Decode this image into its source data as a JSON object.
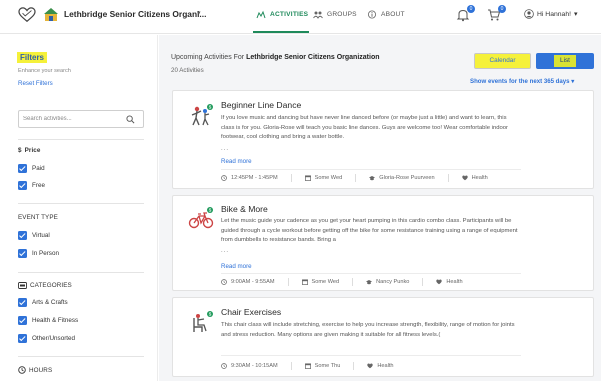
{
  "header": {
    "org_name": "Lethbridge Senior Citizens Organi...",
    "org_caret": "▾",
    "nav": [
      {
        "label": "ACTIVITIES",
        "active": true
      },
      {
        "label": "GROUPS",
        "active": false
      },
      {
        "label": "ABOUT",
        "active": false
      }
    ],
    "notif_count": "0",
    "cart_count": "0",
    "user_greeting": "Hi Hannah!",
    "user_caret": "▾"
  },
  "sidebar": {
    "title": "Filters",
    "subtitle": "Enhance your search",
    "reset": "Reset Filters",
    "search_placeholder": "Search activities...",
    "price": {
      "label": "Price",
      "options": [
        "Paid",
        "Free"
      ]
    },
    "event_type": {
      "label": "EVENT TYPE",
      "options": [
        "Virtual",
        "In Person"
      ]
    },
    "categories": {
      "label": "CATEGORIES",
      "options": [
        "Arts & Crafts",
        "Health & Fitness",
        "Other/Unsorted"
      ]
    },
    "hours": {
      "label": "HOURS"
    }
  },
  "main": {
    "upcoming_prefix": "Upcoming Activities For ",
    "upcoming_org": "Lethbridge Senior Citizens Organization",
    "count": "20 Activities",
    "calendar_label": "Calendar",
    "list_label": "List",
    "show_events": "Show events for the next 365 days",
    "show_caret": "▾",
    "cards": [
      {
        "title": "Beginner Line Dance",
        "desc": "If you love music and dancing but have never line danced before (or maybe just a little) and want to learn, this class is for you. Gloria-Rose will teach you basic line dances. Guys are welcome too! Wear comfortable indoor footwear, cool clothing and bring a water bottle.",
        "dots": "...",
        "read_more": "Read more",
        "time": "12:45PM - 1:45PM",
        "day": "Some Wed",
        "instructor": "Gloria-Rose Puurveen",
        "category": "Health"
      },
      {
        "title": "Bike & More",
        "desc": "Let the music guide your cadence as you get your heart pumping in this cardio combo class. Participants will be guided through a cycle workout before getting off the bike for some resistance training using a range of equipment from dumbbells to resistance bands. Bring a",
        "dots": "...",
        "read_more": "Read more",
        "time": "9:00AM - 9:55AM",
        "day": "Some Wed",
        "instructor": "Nancy Punko",
        "category": "Health"
      },
      {
        "title": "Chair Exercises",
        "desc": "This chair class will include stretching, exercise to help you increase strength, flexibility, range of motion for joints and stress reduction. Many options are given making it suitable for all fitness levels.(",
        "time": "9:30AM - 10:15AM",
        "day": "Some Thu",
        "category": "Health"
      }
    ]
  }
}
